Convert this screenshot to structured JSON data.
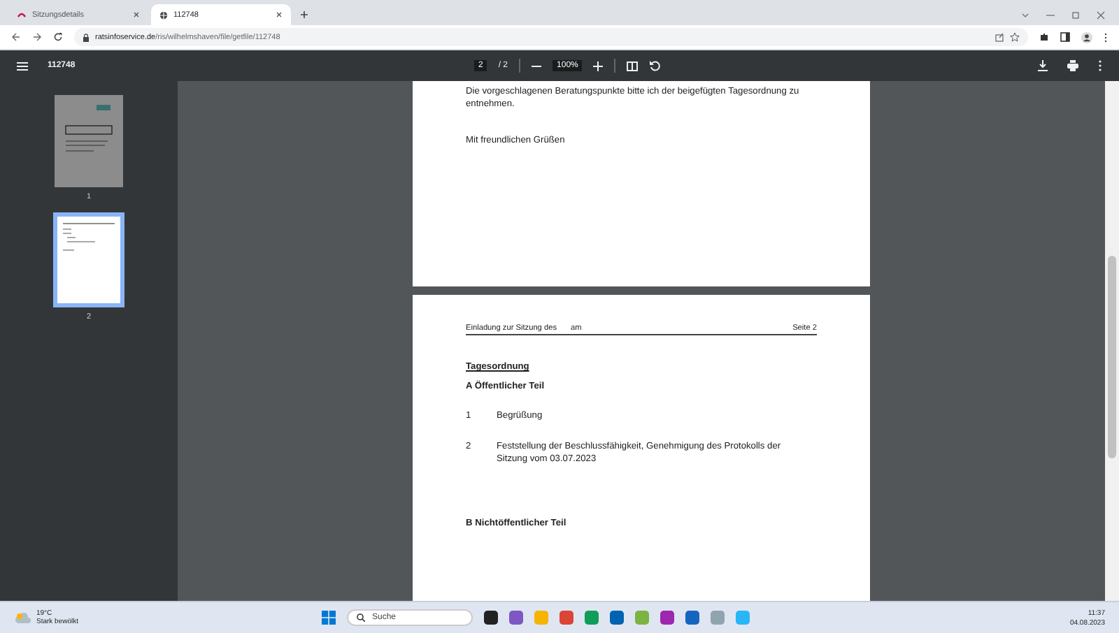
{
  "browser": {
    "tabs": [
      {
        "title": "Sitzungsdetails",
        "selected": false
      },
      {
        "title": "112748",
        "selected": true
      }
    ],
    "url_host": "ratsinfoservice.de",
    "url_path": "/ris/wilhelmshaven/file/getfile/112748"
  },
  "viewer": {
    "title": "112748",
    "page_input": "2",
    "page_total": "/ 2",
    "zoom": "100%"
  },
  "thumbnails": [
    {
      "label": "1",
      "selected": false
    },
    {
      "label": "2",
      "selected": true
    }
  ],
  "page1": {
    "paragraphs": [
      "Die vorgeschlagenen Beratungspunkte bitte ich der beigefügten Tagesordnung zu entnehmen.",
      "Mit freundlichen Grüßen"
    ]
  },
  "page2": {
    "header_parts": [
      "Einladung zur Sitzung des",
      "am"
    ],
    "header_right": "Seite 2",
    "heading": "Tagesordnung",
    "sections": [
      {
        "title": "A Öffentlicher Teil",
        "items": [
          {
            "number": "1",
            "text": "Begrüßung"
          },
          {
            "number": "2",
            "text": "Feststellung der Beschlussfähigkeit, Genehmigung des Protokolls der Sitzung vom 03.07.2023"
          }
        ]
      },
      {
        "title": "B Nichtöffentlicher Teil"
      }
    ]
  },
  "taskbar": {
    "weather_temp": "19°C",
    "weather_text": "Stark bewölkt",
    "search_placeholder": "Suche",
    "time": "11:37",
    "date": "04.08.2023"
  }
}
